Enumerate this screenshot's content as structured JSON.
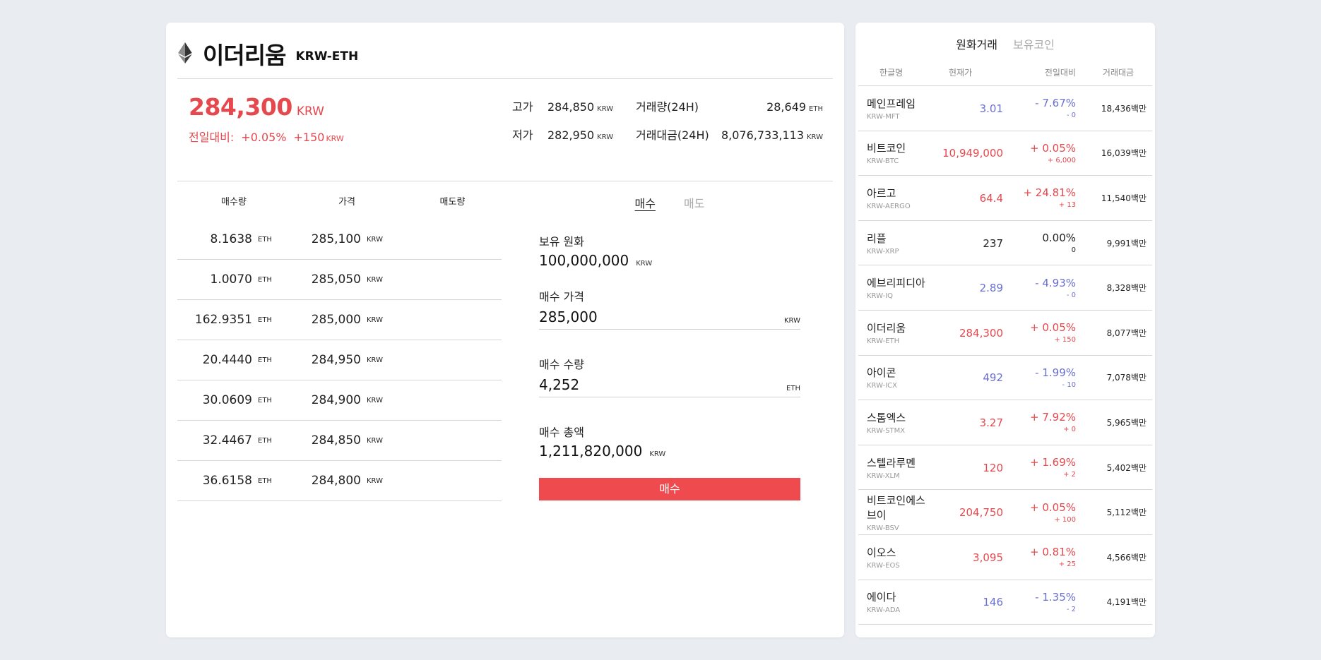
{
  "coin": {
    "name": "이더리움",
    "code": "KRW-ETH",
    "price": "284,300",
    "price_unit": "KRW",
    "change_label": "전일대비:",
    "change_pct": "+0.05%",
    "change_abs": "+150",
    "change_unit": "KRW"
  },
  "stats": {
    "high_label": "고가",
    "high_value": "284,850",
    "high_unit": "KRW",
    "low_label": "저가",
    "low_value": "282,950",
    "low_unit": "KRW",
    "vol_label": "거래량(24H)",
    "vol_value": "28,649",
    "vol_unit": "ETH",
    "amt_label": "거래대금(24H)",
    "amt_value": "8,076,733,113",
    "amt_unit": "KRW"
  },
  "orderbook": {
    "headers": [
      "매수량",
      "가격",
      "매도량"
    ],
    "rows": [
      {
        "qty": "8.1638",
        "qty_unit": "ETH",
        "price": "285,100",
        "price_unit": "KRW"
      },
      {
        "qty": "1.0070",
        "qty_unit": "ETH",
        "price": "285,050",
        "price_unit": "KRW"
      },
      {
        "qty": "162.9351",
        "qty_unit": "ETH",
        "price": "285,000",
        "price_unit": "KRW"
      },
      {
        "qty": "20.4440",
        "qty_unit": "ETH",
        "price": "284,950",
        "price_unit": "KRW"
      },
      {
        "qty": "30.0609",
        "qty_unit": "ETH",
        "price": "284,900",
        "price_unit": "KRW"
      },
      {
        "qty": "32.4467",
        "qty_unit": "ETH",
        "price": "284,850",
        "price_unit": "KRW"
      },
      {
        "qty": "36.6158",
        "qty_unit": "ETH",
        "price": "284,800",
        "price_unit": "KRW"
      }
    ]
  },
  "order": {
    "tab_buy": "매수",
    "tab_sell": "매도",
    "balance_label": "보유 원화",
    "balance_value": "100,000,000",
    "balance_unit": "KRW",
    "price_label": "매수 가격",
    "price_value": "285,000",
    "price_unit": "KRW",
    "qty_label": "매수 수량",
    "qty_value": "4,252",
    "qty_unit": "ETH",
    "total_label": "매수 총액",
    "total_value": "1,211,820,000",
    "total_unit": "KRW",
    "submit_label": "매수"
  },
  "market": {
    "tab_krw": "원화거래",
    "tab_holding": "보유코인",
    "headers": [
      "한글명",
      "현재가",
      "전일대비",
      "거래대금"
    ],
    "rows": [
      {
        "name": "메인프레임",
        "code": "KRW-MFT",
        "price": "3.01",
        "pct": "- 7.67%",
        "delta": "- 0",
        "amount": "18,436백만",
        "dir": "down"
      },
      {
        "name": "비트코인",
        "code": "KRW-BTC",
        "price": "10,949,000",
        "pct": "+ 0.05%",
        "delta": "+ 6,000",
        "amount": "16,039백만",
        "dir": "up"
      },
      {
        "name": "아르고",
        "code": "KRW-AERGO",
        "price": "64.4",
        "pct": "+ 24.81%",
        "delta": "+ 13",
        "amount": "11,540백만",
        "dir": "up"
      },
      {
        "name": "리플",
        "code": "KRW-XRP",
        "price": "237",
        "pct": "0.00%",
        "delta": "0",
        "amount": "9,991백만",
        "dir": "flat"
      },
      {
        "name": "에브리피디아",
        "code": "KRW-IQ",
        "price": "2.89",
        "pct": "- 4.93%",
        "delta": "- 0",
        "amount": "8,328백만",
        "dir": "down"
      },
      {
        "name": "이더리움",
        "code": "KRW-ETH",
        "price": "284,300",
        "pct": "+ 0.05%",
        "delta": "+ 150",
        "amount": "8,077백만",
        "dir": "up"
      },
      {
        "name": "아이콘",
        "code": "KRW-ICX",
        "price": "492",
        "pct": "- 1.99%",
        "delta": "- 10",
        "amount": "7,078백만",
        "dir": "down"
      },
      {
        "name": "스톰엑스",
        "code": "KRW-STMX",
        "price": "3.27",
        "pct": "+ 7.92%",
        "delta": "+ 0",
        "amount": "5,965백만",
        "dir": "up"
      },
      {
        "name": "스텔라루멘",
        "code": "KRW-XLM",
        "price": "120",
        "pct": "+ 1.69%",
        "delta": "+ 2",
        "amount": "5,402백만",
        "dir": "up"
      },
      {
        "name": "비트코인에스브이",
        "code": "KRW-BSV",
        "price": "204,750",
        "pct": "+ 0.05%",
        "delta": "+ 100",
        "amount": "5,112백만",
        "dir": "up"
      },
      {
        "name": "이오스",
        "code": "KRW-EOS",
        "price": "3,095",
        "pct": "+ 0.81%",
        "delta": "+ 25",
        "amount": "4,566백만",
        "dir": "up"
      },
      {
        "name": "에이다",
        "code": "KRW-ADA",
        "price": "146",
        "pct": "- 1.35%",
        "delta": "- 2",
        "amount": "4,191백만",
        "dir": "down"
      }
    ]
  },
  "colors": {
    "up": "#e5484d",
    "down": "#6a6fd0",
    "buy_button": "#ef4b4f",
    "background": "#e9ecf1"
  },
  "icons": {
    "coin": "ethereum-icon"
  }
}
